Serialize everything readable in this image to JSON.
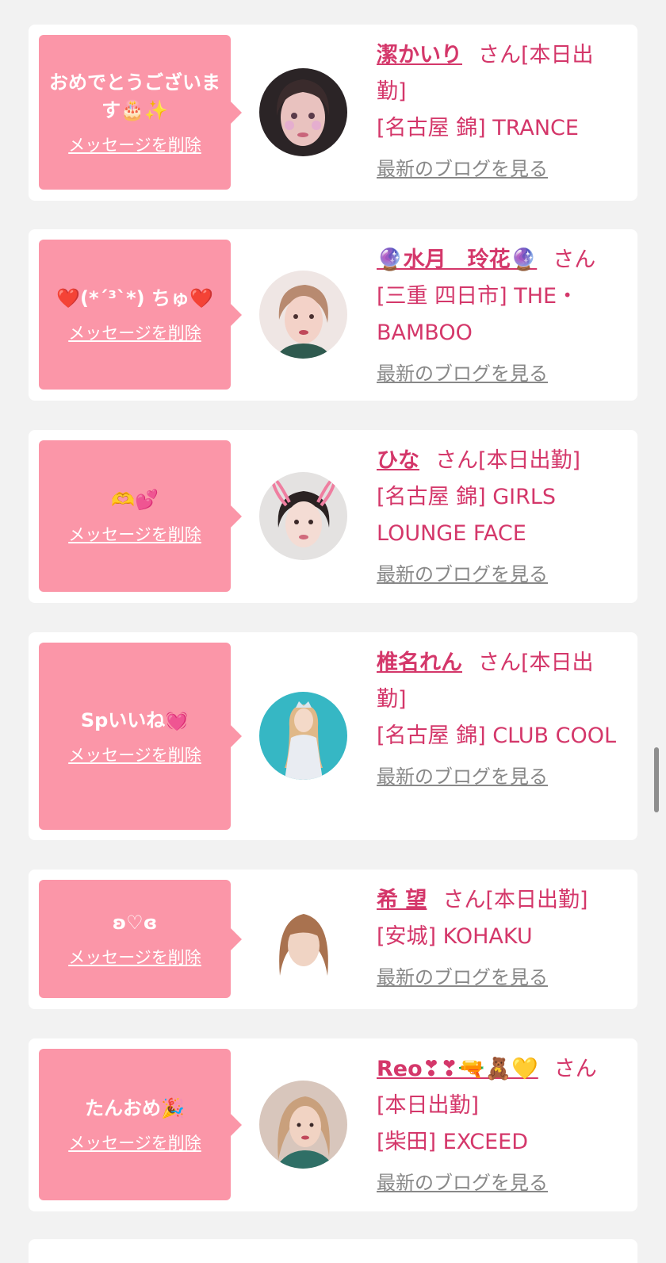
{
  "ui": {
    "delete_label": "メッセージを削除",
    "blog_label": "最新のブログを見る",
    "san_label": "さん"
  },
  "colors": {
    "bubble": "#fb96a8",
    "accent": "#d4376a",
    "link_gray": "#888888",
    "background": "#f2f2f2"
  },
  "cards": [
    {
      "message": "おめでとうございます🎂✨",
      "name": "潔かいり",
      "status": "[本日出勤]",
      "location_shop": "[名古屋 錦] TRANCE",
      "avatar_icon": "girl-sparkle-avatar"
    },
    {
      "message": "❤️(*´³`*) ちゅ❤️",
      "name": "🔮水月　玲花🔮",
      "status": "",
      "location_shop": "[三重 四日市] THE・BAMBOO",
      "avatar_icon": "girl-avatar"
    },
    {
      "message": "🫶💕",
      "name": "ひな",
      "status": "[本日出勤]",
      "location_shop": "[名古屋 錦] GIRLS LOUNGE FACE",
      "avatar_icon": "bunny-ears-avatar"
    },
    {
      "message": "Spいいね💓",
      "name": "椎名れん",
      "status": "[本日出勤]",
      "location_shop": "[名古屋 錦] CLUB COOL",
      "avatar_icon": "girl-blue-background-avatar"
    },
    {
      "message": "ʚ♡ɞ",
      "name": "希 望",
      "status": "[本日出勤]",
      "location_shop": "[安城] KOHAKU",
      "avatar_icon": "blurred-girl-avatar"
    },
    {
      "message": "たんおめ🎉",
      "name": "Reo❣❣🔫🧸💛",
      "status": "[本日出勤]",
      "location_shop": "[柴田] EXCEED",
      "avatar_icon": "girl-avatar"
    }
  ]
}
